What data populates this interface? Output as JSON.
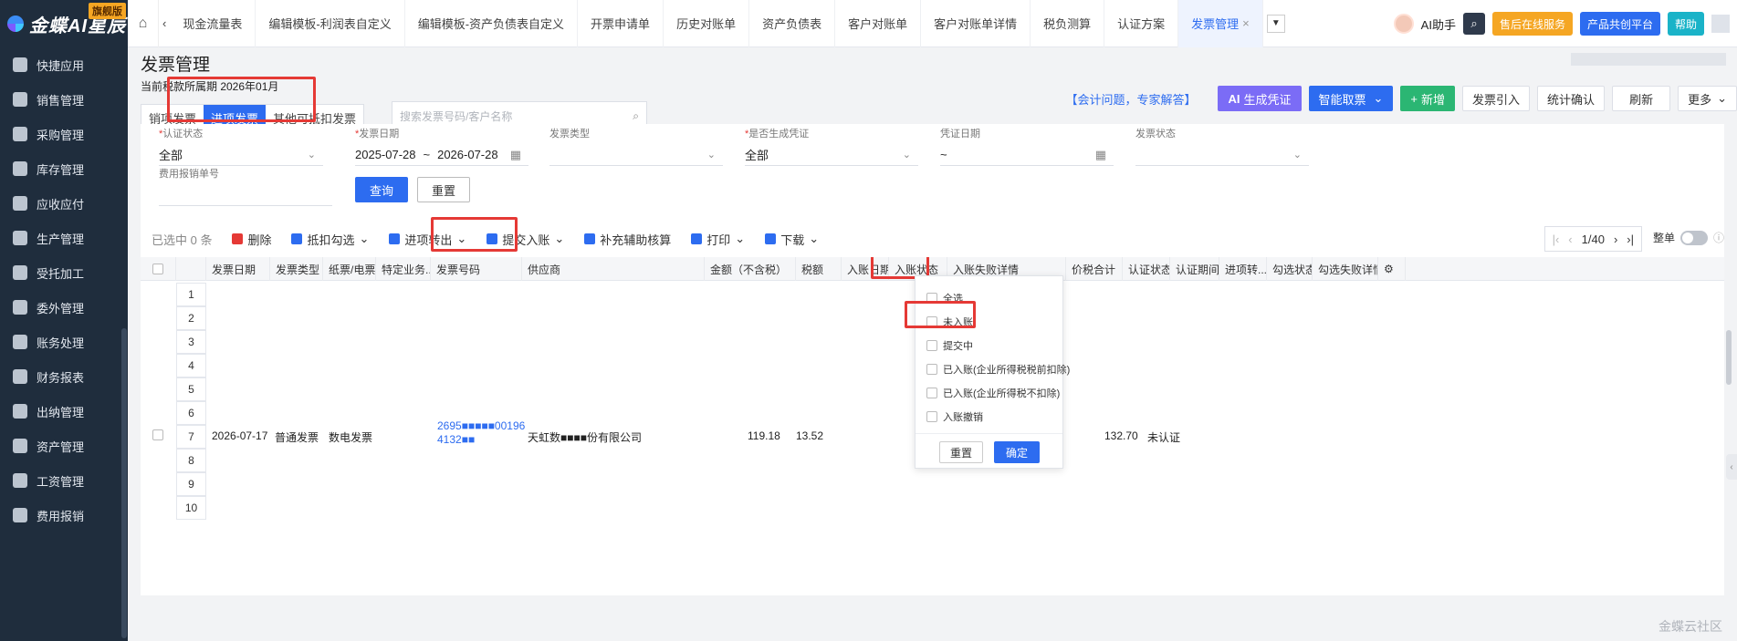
{
  "brand": {
    "name": "金蝶AI星辰",
    "badge": "旗舰版"
  },
  "sidebar": {
    "items": [
      {
        "label": "快捷应用",
        "icon": "grid-icon"
      },
      {
        "label": "销售管理",
        "icon": "chart-icon"
      },
      {
        "label": "采购管理",
        "icon": "cart-icon"
      },
      {
        "label": "库存管理",
        "icon": "box-icon"
      },
      {
        "label": "应收应付",
        "icon": "coin-icon"
      },
      {
        "label": "生产管理",
        "icon": "factory-icon"
      },
      {
        "label": "受托加工",
        "icon": "tools-icon"
      },
      {
        "label": "委外管理",
        "icon": "outsource-icon"
      },
      {
        "label": "账务处理",
        "icon": "ledger-icon"
      },
      {
        "label": "财务报表",
        "icon": "report-icon"
      },
      {
        "label": "出纳管理",
        "icon": "cashier-icon"
      },
      {
        "label": "资产管理",
        "icon": "asset-icon"
      },
      {
        "label": "工资管理",
        "icon": "salary-icon"
      },
      {
        "label": "费用报销",
        "icon": "expense-icon"
      }
    ]
  },
  "tabs": [
    {
      "label": "现金流量表",
      "active": false
    },
    {
      "label": "编辑模板-利润表自定义",
      "active": false
    },
    {
      "label": "编辑模板-资产负债表自定义",
      "active": false
    },
    {
      "label": "开票申请单",
      "active": false
    },
    {
      "label": "历史对账单",
      "active": false
    },
    {
      "label": "资产负债表",
      "active": false
    },
    {
      "label": "客户对账单",
      "active": false
    },
    {
      "label": "客户对账单详情",
      "active": false
    },
    {
      "label": "税负测算",
      "active": false
    },
    {
      "label": "认证方案",
      "active": false
    },
    {
      "label": "发票管理",
      "active": true
    }
  ],
  "topright": {
    "ai": "AI助手",
    "service": "售后在线服务",
    "platform": "产品共创平台",
    "help": "帮助"
  },
  "page": {
    "title": "发票管理",
    "period": "当前税款所属期 2026年01月"
  },
  "segments": [
    {
      "label": "销项发票",
      "active": false
    },
    {
      "label": "进项发票",
      "active": true
    },
    {
      "label": "其他可抵扣发票",
      "active": false
    }
  ],
  "search": {
    "placeholder": "搜索发票号码/客户名称"
  },
  "actions": {
    "consult": "【会计问题，专家解答】",
    "voucher": "生成凭证",
    "smart": "智能取票",
    "add": "新增",
    "import": "发票引入",
    "stat": "统计确认",
    "refresh": "刷新",
    "more": "更多"
  },
  "filters": {
    "cert_status": {
      "label": "认证状态",
      "value": "全部"
    },
    "invoice_date": {
      "label": "发票日期",
      "from": "2025-07-28",
      "to": "2026-07-28",
      "sep": "~"
    },
    "invoice_type": {
      "label": "发票类型",
      "value": ""
    },
    "voucher_gen": {
      "label": "是否生成凭证",
      "value": "全部"
    },
    "voucher_date": {
      "label": "凭证日期",
      "sep": "~"
    },
    "invoice_status": {
      "label": "发票状态",
      "value": ""
    },
    "expense_no": {
      "label": "费用报销单号",
      "value": ""
    },
    "query": "查询",
    "reset": "重置"
  },
  "toolbar": {
    "selected": "已选中 0 条",
    "delete": "删除",
    "deduct": "抵扣勾选",
    "transfer": "进项转出",
    "submit": "提交入账",
    "supplement": "补充辅助核算",
    "print": "打印",
    "download": "下载",
    "page": "1/40",
    "whole": "整单"
  },
  "columns": [
    "发票日期",
    "发票类型",
    "纸票/电票",
    "特定业务...",
    "发票号码",
    "供应商",
    "金额（不含税）",
    "税额",
    "入账日期",
    "入账状态",
    "入账失败详情",
    "价税合计",
    "认证状态",
    "认证期间",
    "进项转...",
    "勾选状态",
    "勾选失败详情"
  ],
  "rows": [
    "1",
    "2",
    "3",
    "4",
    "5",
    "6",
    "7",
    "8",
    "9",
    "10"
  ],
  "record": {
    "date": "2026-07-17",
    "type": "普通发票",
    "medium": "数电发票",
    "number_line1": "2695■■■■■00196",
    "number_line2": "4132■■",
    "supplier": "天虹数■■■■份有限公司",
    "amount": "119.18",
    "tax": "13.52",
    "total": "132.70",
    "cert": "未认证"
  },
  "dropdown": {
    "options": [
      "全选",
      "未入账",
      "提交中",
      "已入账(企业所得税税前扣除)",
      "已入账(企业所得税不扣除)",
      "入账撤销"
    ],
    "reset": "重置",
    "confirm": "确定"
  },
  "watermark": "金蝶云社区",
  "colors": {
    "accent": "#2d6cf0",
    "highlight": "#e53935",
    "sidebar": "#1f2d3d"
  }
}
